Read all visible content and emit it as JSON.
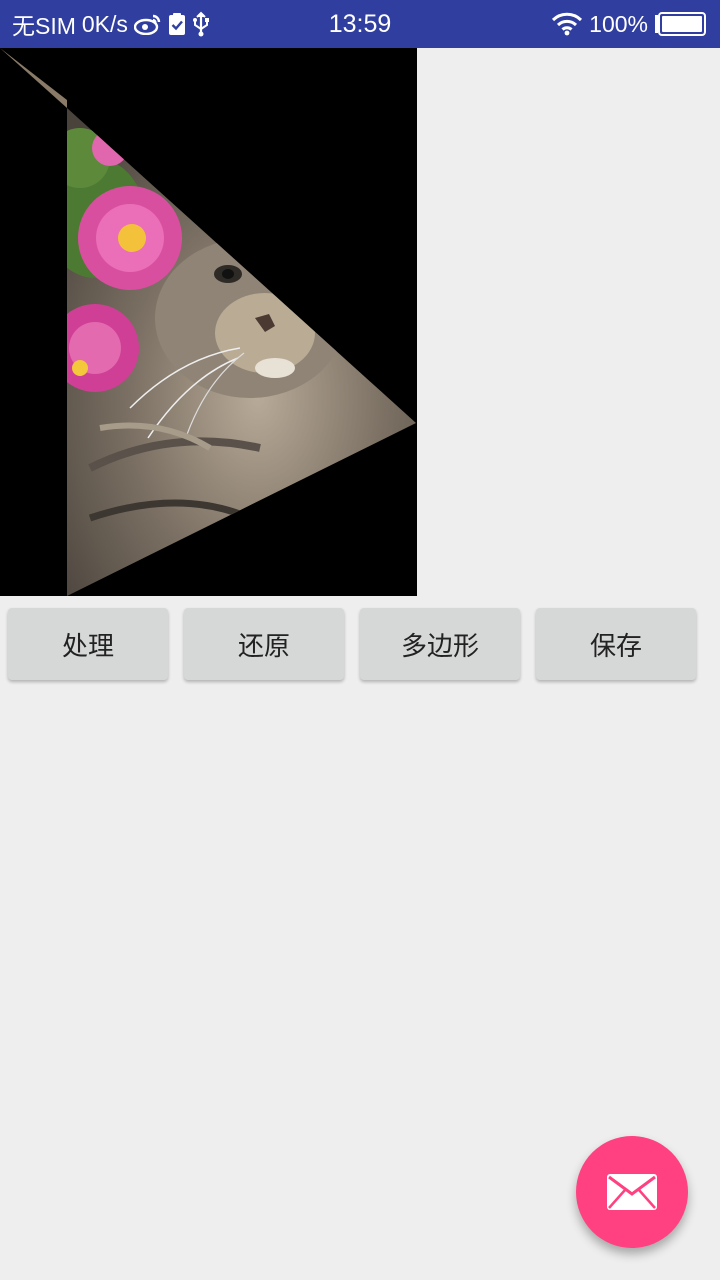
{
  "status_bar": {
    "carrier": "无SIM",
    "speed": "0K/s",
    "time": "13:59",
    "battery": "100%",
    "icons": [
      "weibo-icon",
      "clipboard-check-icon",
      "usb-icon",
      "wifi-icon",
      "battery-icon"
    ]
  },
  "image_view": {
    "description_icon": "cat-photo-triangle-clip"
  },
  "buttons": {
    "process": "处理",
    "restore": "还原",
    "polygon": "多边形",
    "save": "保存"
  },
  "fab": {
    "icon": "mail-icon",
    "color": "#ff4081"
  },
  "colors": {
    "status_bar": "#303f9f",
    "background": "#eeeeee",
    "button": "#d6d7d7"
  }
}
